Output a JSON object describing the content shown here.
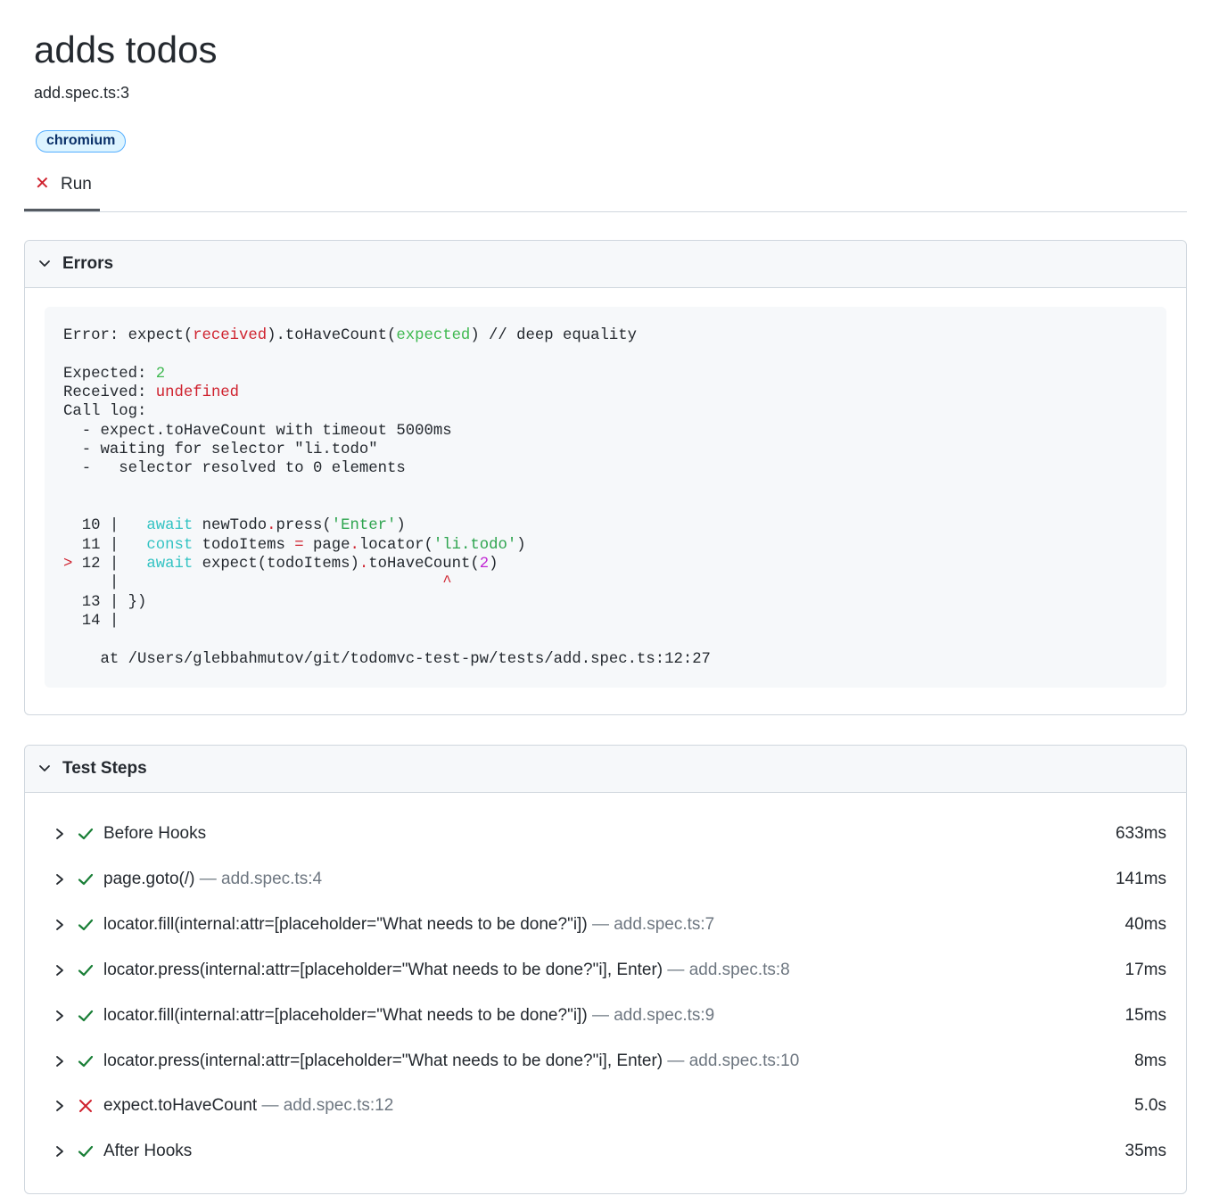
{
  "test": {
    "title": "adds todos",
    "location": "add.spec.ts:3",
    "project_badge": "chromium"
  },
  "tabs": [
    {
      "label": "Run",
      "status": "failed",
      "selected": true
    }
  ],
  "errors_panel": {
    "title": "Errors",
    "expanded": true,
    "error": {
      "header_prefix": "Error: expect(",
      "header_received": "received",
      "header_mid": ").toHaveCount(",
      "header_expected": "expected",
      "header_suffix": ") // deep equality",
      "expected_label": "Expected: ",
      "expected_value": "2",
      "received_label": "Received: ",
      "received_value": "undefined",
      "call_log_label": "Call log:",
      "call_log": [
        "  - expect.toHaveCount with timeout 5000ms",
        "  - waiting for selector \"li.todo\"",
        "  -   selector resolved to 0 elements"
      ],
      "snippet": {
        "line10_num": "  10 |   ",
        "line10_kw": "await",
        "line10_a": " newTodo",
        "line10_dot": ".",
        "line10_b": "press(",
        "line10_str": "'Enter'",
        "line10_c": ")",
        "line11_num": "  11 |   ",
        "line11_kw": "const",
        "line11_a": " todoItems ",
        "line11_eq": "=",
        "line11_b": " page",
        "line11_dot": ".",
        "line11_c": "locator(",
        "line11_str": "'li.todo'",
        "line11_d": ")",
        "line12_marker": "> ",
        "line12_num": "12 |   ",
        "line12_kw": "await",
        "line12_a": " expect(todoItems)",
        "line12_dot": ".",
        "line12_b": "toHaveCount(",
        "line12_num_val": "2",
        "line12_c": ")",
        "caret_line_prefix": "     |",
        "caret_spaces": "                                   ",
        "caret": "^",
        "line13": "  13 | })",
        "line14": "  14 |"
      },
      "stack": "    at /Users/glebbahmutov/git/todomvc-test-pw/tests/add.spec.ts:12:27"
    }
  },
  "steps_panel": {
    "title": "Test Steps",
    "expanded": true,
    "steps": [
      {
        "title": "Before Hooks",
        "location": "",
        "duration": "633ms",
        "status": "passed"
      },
      {
        "title": "page.goto(/)",
        "location": "— add.spec.ts:4",
        "duration": "141ms",
        "status": "passed"
      },
      {
        "title": "locator.fill(internal:attr=[placeholder=\"What needs to be done?\"i])",
        "location": "— add.spec.ts:7",
        "duration": "40ms",
        "status": "passed"
      },
      {
        "title": "locator.press(internal:attr=[placeholder=\"What needs to be done?\"i], Enter)",
        "location": "— add.spec.ts:8",
        "duration": "17ms",
        "status": "passed"
      },
      {
        "title": "locator.fill(internal:attr=[placeholder=\"What needs to be done?\"i])",
        "location": "— add.spec.ts:9",
        "duration": "15ms",
        "status": "passed"
      },
      {
        "title": "locator.press(internal:attr=[placeholder=\"What needs to be done?\"i], Enter)",
        "location": "— add.spec.ts:10",
        "duration": "8ms",
        "status": "passed"
      },
      {
        "title": "expect.toHaveCount",
        "location": "— add.spec.ts:12",
        "duration": "5.0s",
        "status": "failed"
      },
      {
        "title": "After Hooks",
        "location": "",
        "duration": "35ms",
        "status": "passed"
      }
    ]
  },
  "icons": {
    "tab_status": "x-icon",
    "expand": "chevron-down-icon",
    "step_expand": "chevron-right-icon",
    "passed": "check-icon",
    "failed": "x-icon"
  },
  "colors": {
    "passed": "#1a7f37",
    "failed": "#cf222e",
    "badge_border": "#54aeff",
    "badge_bg": "#ddf4ff"
  }
}
